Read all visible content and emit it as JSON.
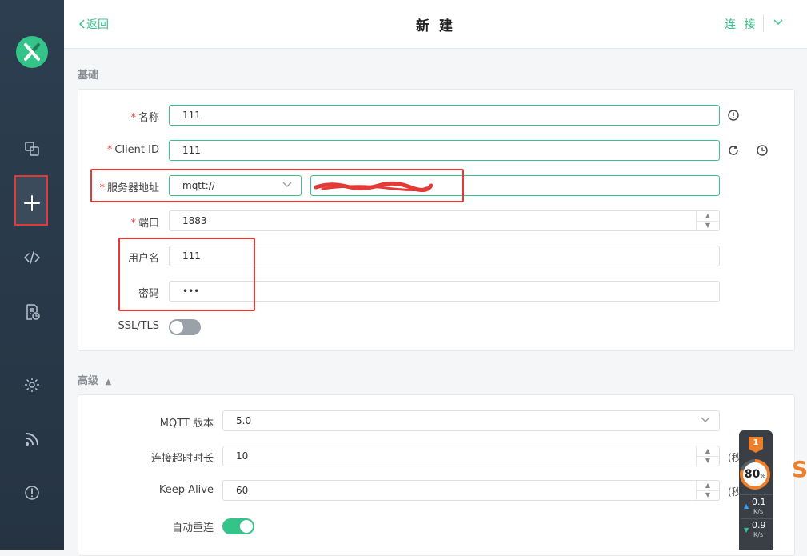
{
  "header": {
    "back_label": "返回",
    "title": "新 建",
    "connect_label": "连 接"
  },
  "basic": {
    "section_title": "基础",
    "name": {
      "label": "名称",
      "value": "111"
    },
    "client_id": {
      "label": "Client ID",
      "value": "111"
    },
    "server": {
      "label": "服务器地址",
      "protocol": "mqtt://",
      "host": ""
    },
    "port": {
      "label": "端口",
      "value": "1883"
    },
    "username": {
      "label": "用户名",
      "value": "111"
    },
    "password": {
      "label": "密码",
      "value": "•••"
    },
    "ssl": {
      "label": "SSL/TLS",
      "enabled": false
    }
  },
  "advanced": {
    "section_title": "高级",
    "mqtt_version": {
      "label": "MQTT 版本",
      "value": "5.0"
    },
    "connect_timeout": {
      "label": "连接超时时长",
      "value": "10",
      "unit": "(秒"
    },
    "keep_alive": {
      "label": "Keep Alive",
      "value": "60",
      "unit": "(秒"
    },
    "auto_reconnect": {
      "label": "自动重连",
      "enabled": true
    }
  },
  "monitor": {
    "badge": "1",
    "percent": "80",
    "percent_sign": "%",
    "upload": "0.1",
    "download": "0.9",
    "unit": "K/s"
  },
  "colors": {
    "accent": "#34c388",
    "sidebar": "#2c3e50",
    "required": "#e53935",
    "annotation": "#e53935",
    "monitor_accent": "#f07f2b"
  }
}
